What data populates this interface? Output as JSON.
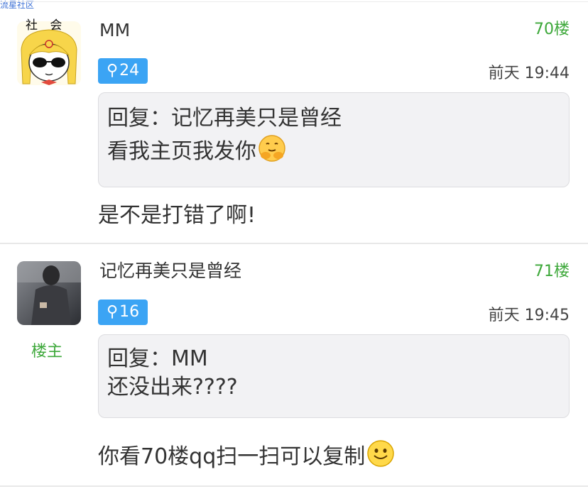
{
  "watermark": "流星社区",
  "posts": [
    {
      "username": "MM",
      "floor": "70楼",
      "level": "24",
      "time": "前天 19:44",
      "avatar_text": "社 会",
      "quote_lines": [
        "回复：记忆再美只是曾经",
        "看我主页我发你"
      ],
      "quote_emoji": "hugging-face-icon",
      "body": "是不是打错了啊!"
    },
    {
      "username": "记忆再美只是曾经",
      "floor": "71楼",
      "level": "16",
      "time": "前天 19:45",
      "owner_tag": "楼主",
      "quote_lines": [
        "回复：MM",
        "还没出来????"
      ],
      "body": "你看70楼qq扫一扫可以复制",
      "body_emoji": "smile-face-icon"
    }
  ],
  "colors": {
    "floor_green": "#3da83a",
    "badge_blue": "#3ba4f4",
    "quote_bg": "#f2f2f4"
  },
  "icons": {
    "badge": "male-icon",
    "avatar_1": "cartoon-girl-sunglasses-avatar",
    "avatar_2": "photo-person-avatar"
  }
}
